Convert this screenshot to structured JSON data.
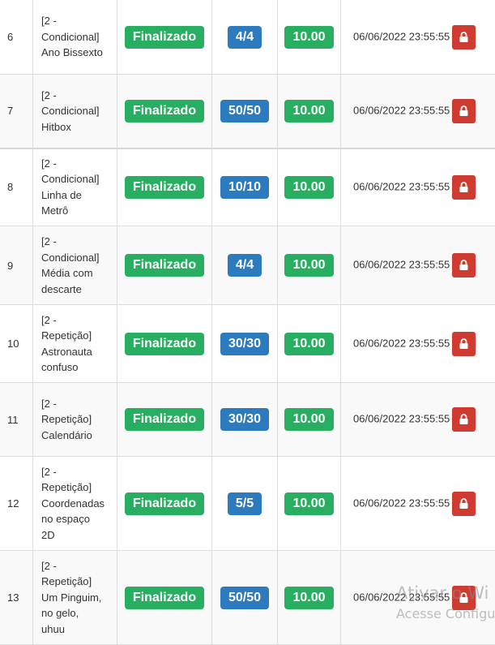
{
  "rows": [
    {
      "num": "6",
      "name_lines": [
        "[2 -",
        "Condicional]",
        "Ano Bissexto"
      ],
      "status": "Finalizado",
      "score": "4/4",
      "grade": "10.00",
      "date": "06/06/2022 23:55:55",
      "lock_icon": "lock-icon"
    },
    {
      "num": "7",
      "name_lines": [
        "[2 -",
        "Condicional]",
        "Hitbox"
      ],
      "status": "Finalizado",
      "score": "50/50",
      "grade": "10.00",
      "date": "06/06/2022 23:55:55",
      "lock_icon": "lock-icon"
    },
    {
      "num": "8",
      "name_lines": [
        "[2 -",
        "Condicional]",
        "Linha de",
        "Metrô"
      ],
      "status": "Finalizado",
      "score": "10/10",
      "grade": "10.00",
      "date": "06/06/2022 23:55:55",
      "lock_icon": "lock-icon"
    },
    {
      "num": "9",
      "name_lines": [
        "[2 -",
        "Condicional]",
        "Média com",
        "descarte"
      ],
      "status": "Finalizado",
      "score": "4/4",
      "grade": "10.00",
      "date": "06/06/2022 23:55:55",
      "lock_icon": "lock-icon"
    },
    {
      "num": "10",
      "name_lines": [
        "[2 -",
        "Repetição]",
        "Astronauta",
        "confuso"
      ],
      "status": "Finalizado",
      "score": "30/30",
      "grade": "10.00",
      "date": "06/06/2022 23:55:55",
      "lock_icon": "lock-icon"
    },
    {
      "num": "11",
      "name_lines": [
        "[2 -",
        "Repetição]",
        "Calendário"
      ],
      "status": "Finalizado",
      "score": "30/30",
      "grade": "10.00",
      "date": "06/06/2022 23:55:55",
      "lock_icon": "lock-icon"
    },
    {
      "num": "12",
      "name_lines": [
        "[2 -",
        "Repetição]",
        "Coordenadas",
        "no espaço",
        "2D"
      ],
      "status": "Finalizado",
      "score": "5/5",
      "grade": "10.00",
      "date": "06/06/2022 23:55:55",
      "lock_icon": "lock-icon"
    },
    {
      "num": "13",
      "name_lines": [
        "[2 -",
        "Repetição]",
        "Um Pinguim,",
        "no gelo,",
        "uhuu"
      ],
      "status": "Finalizado",
      "score": "50/50",
      "grade": "10.00",
      "date": "06/06/2022 23:55:55",
      "lock_icon": "lock-icon"
    }
  ],
  "colors": {
    "status_badge": "#27ae60",
    "score_badge": "#2d7bbf",
    "grade_badge": "#27ae60",
    "lock_button": "#cf3b31"
  },
  "watermark": {
    "line1": "Ativar o Wi",
    "line2": "Acesse Configu"
  }
}
